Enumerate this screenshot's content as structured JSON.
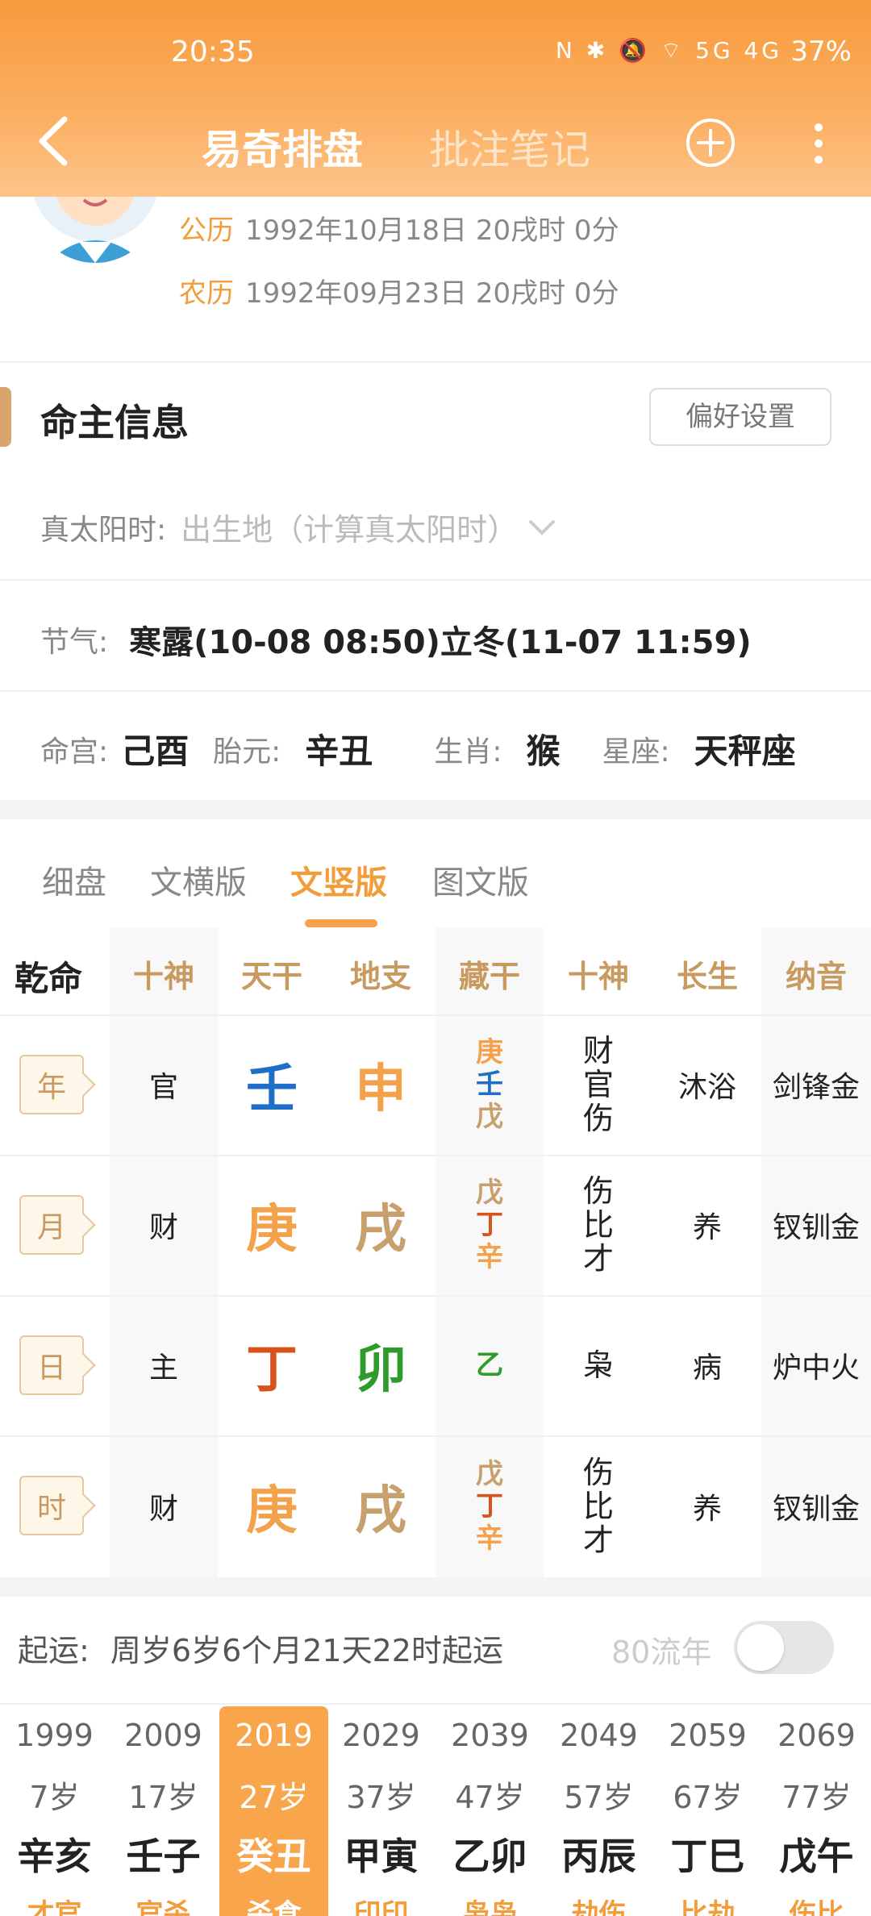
{
  "status_bar": {
    "time": "20:35",
    "icons": "N ✱ 🔕 ⌔ 5G 4G",
    "battery": "37%"
  },
  "nav": {
    "title_main": "易奇排盘",
    "title_secondary": "批注笔记"
  },
  "profile": {
    "gregorian_label": "公历",
    "gregorian_value": "1992年10月18日 20戌时 0分",
    "lunar_label": "农历",
    "lunar_value": "1992年09月23日 20戌时 0分"
  },
  "section": {
    "title": "命主信息",
    "pref_button": "偏好设置"
  },
  "solar_time": {
    "label": "真太阳时:",
    "placeholder": "出生地（计算真太阳时）"
  },
  "solar_terms": {
    "label": "节气:",
    "value": "寒露(10-08 08:50)立冬(11-07 11:59)"
  },
  "info": {
    "minggong_label": "命宫:",
    "minggong": "己酉",
    "taiyuan_label": "胎元:",
    "taiyuan": "辛丑",
    "shengxiao_label": "生肖:",
    "shengxiao": "猴",
    "xingzuo_label": "星座:",
    "xingzuo": "天秤座"
  },
  "tabs": [
    "细盘",
    "文横版",
    "文竖版",
    "图文版"
  ],
  "table": {
    "corner": "乾命",
    "headers": [
      "十神",
      "天干",
      "地支",
      "藏干",
      "十神",
      "长生",
      "纳音"
    ],
    "rows": [
      {
        "pillar": "年",
        "shishen": "官",
        "tiangan": "壬",
        "dizhi": "申",
        "canggan": [
          "庚",
          "壬",
          "戊"
        ],
        "shishen2": [
          "财",
          "官",
          "伤"
        ],
        "changsheng": "沐浴",
        "nayin": "剑锋金"
      },
      {
        "pillar": "月",
        "shishen": "财",
        "tiangan": "庚",
        "dizhi": "戌",
        "canggan": [
          "戊",
          "丁",
          "辛"
        ],
        "shishen2": [
          "伤",
          "比",
          "才"
        ],
        "changsheng": "养",
        "nayin": "钗钏金"
      },
      {
        "pillar": "日",
        "shishen": "主",
        "tiangan": "丁",
        "dizhi": "卯",
        "canggan": [
          "乙"
        ],
        "shishen2": [
          "枭"
        ],
        "changsheng": "病",
        "nayin": "炉中火"
      },
      {
        "pillar": "时",
        "shishen": "财",
        "tiangan": "庚",
        "dizhi": "戌",
        "canggan": [
          "戊",
          "丁",
          "辛"
        ],
        "shishen2": [
          "伤",
          "比",
          "才"
        ],
        "changsheng": "养",
        "nayin": "钗钏金"
      }
    ]
  },
  "colors": {
    "accent": "#f29c3a",
    "water": "#1f6fc9",
    "metal": "#f3a24b",
    "earth": "#c8a06e",
    "fire": "#d8531c",
    "wood": "#2f9b2a"
  },
  "qiyun": {
    "label": "起运:",
    "value": "周岁6岁6个月21天22时起运",
    "flow_label": "80流年"
  },
  "dayun": [
    {
      "year": "1999",
      "age": "7岁",
      "gz": "辛亥",
      "sub": "才官"
    },
    {
      "year": "2009",
      "age": "17岁",
      "gz": "壬子",
      "sub": "官杀"
    },
    {
      "year": "2019",
      "age": "27岁",
      "gz": "癸丑",
      "sub": "杀食"
    },
    {
      "year": "2029",
      "age": "37岁",
      "gz": "甲寅",
      "sub": "印印"
    },
    {
      "year": "2039",
      "age": "47岁",
      "gz": "乙卯",
      "sub": "枭枭"
    },
    {
      "year": "2049",
      "age": "57岁",
      "gz": "丙辰",
      "sub": "劫伤"
    },
    {
      "year": "2059",
      "age": "67岁",
      "gz": "丁巳",
      "sub": "比劫"
    },
    {
      "year": "2069",
      "age": "77岁",
      "gz": "戊午",
      "sub": "伤比"
    }
  ]
}
